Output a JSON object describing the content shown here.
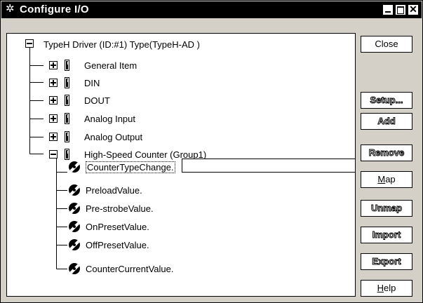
{
  "window": {
    "title": "Configure I/O",
    "icon": "gear-icon",
    "controls": {
      "minimize": "minimize-icon",
      "maximize": "maximize-icon",
      "close": "✕"
    }
  },
  "tree": {
    "root": {
      "label": "TypeH Driver (ID:#1) Type(TypeH-AD )",
      "expanded": true
    },
    "groups": [
      {
        "label": "General Item",
        "expanded": false
      },
      {
        "label": "DIN",
        "expanded": false
      },
      {
        "label": "DOUT",
        "expanded": false
      },
      {
        "label": "Analog Input",
        "expanded": false
      },
      {
        "label": "Analog Output",
        "expanded": false
      },
      {
        "label": "High-Speed Counter (Group1)",
        "expanded": true
      }
    ],
    "items": [
      {
        "label": "CounterTypeChange."
      },
      {
        "label": "PreloadValue."
      },
      {
        "label": "Pre-strobeValue."
      },
      {
        "label": "OnPresetValue."
      },
      {
        "label": "OffPresetValue."
      },
      {
        "label": "CounterCurrentValue."
      }
    ],
    "edit_value": ""
  },
  "buttons": {
    "close": {
      "label": "Close",
      "mnemonic": ""
    },
    "setup": {
      "label": "Setup...",
      "mnemonic": "S",
      "enabled": false
    },
    "add": {
      "label": "Add",
      "mnemonic": "A",
      "enabled": false
    },
    "remove": {
      "label": "Remove",
      "mnemonic": "R",
      "enabled": false
    },
    "map": {
      "first": "M",
      "rest": "ap",
      "enabled": true
    },
    "unmap": {
      "label": "Unmap",
      "mnemonic": "U",
      "enabled": false
    },
    "import": {
      "label": "Import",
      "mnemonic": "I",
      "enabled": false
    },
    "export": {
      "label": "Export",
      "mnemonic": "E",
      "enabled": false
    },
    "help": {
      "first": "H",
      "rest": "elp",
      "enabled": true
    }
  }
}
